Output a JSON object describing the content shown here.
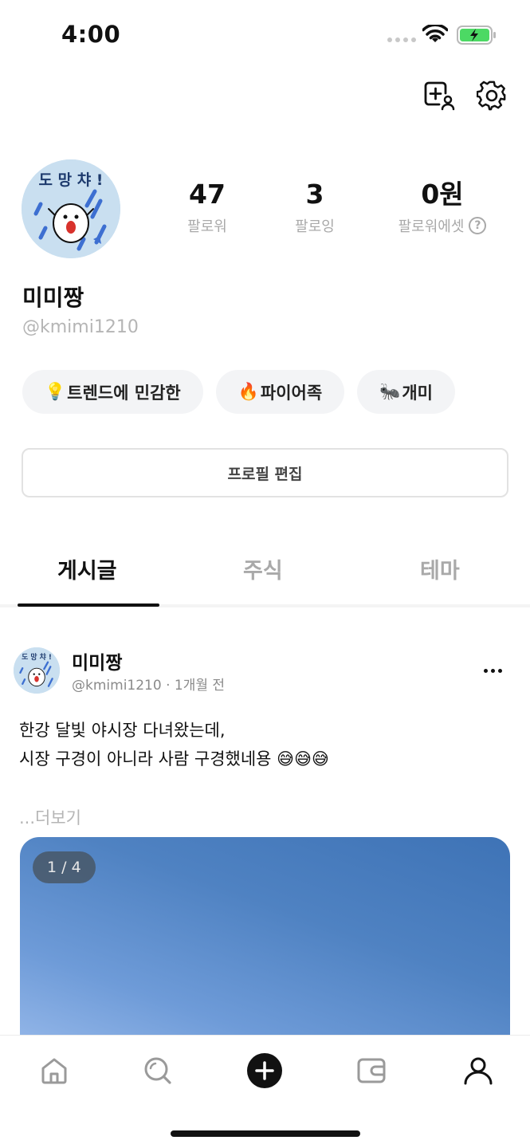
{
  "status_bar": {
    "time": "4:00"
  },
  "profile": {
    "display_name": "미미짱",
    "handle": "@kmimi1210",
    "avatar_text": "도 망 챠 !",
    "stats": {
      "followers_value": "47",
      "followers_label": "팔로워",
      "following_value": "3",
      "following_label": "팔로잉",
      "assets_value": "0원",
      "assets_label": "팔로워에셋"
    },
    "badges": [
      {
        "emoji": "💡",
        "label": "트렌드에 민감한"
      },
      {
        "emoji": "🔥",
        "label": "파이어족"
      },
      {
        "emoji": "🐜",
        "label": "개미"
      }
    ],
    "edit_button": "프로필 편집"
  },
  "tabs": [
    {
      "label": "게시글",
      "active": true
    },
    {
      "label": "주식",
      "active": false
    },
    {
      "label": "테마",
      "active": false
    }
  ],
  "post": {
    "author": "미미짱",
    "handle": "@kmimi1210",
    "time": "· 1개월 전",
    "body": "한강 달빛 야시장 다녀왔는데,\n시장 구경이 아니라 사람 구경했네용 😅😅😅",
    "read_more": "...더보기",
    "image_counter": "1 / 4"
  },
  "colors": {
    "accent": "#111111",
    "muted": "#a9a9a9",
    "badge_bg": "#f3f4f6",
    "battery": "#4cd964"
  },
  "icons": [
    "add-friend-icon",
    "settings-gear-icon",
    "help-icon",
    "more-icon",
    "home-icon",
    "search-icon",
    "plus-icon",
    "wallet-icon",
    "profile-icon",
    "wifi-icon",
    "battery-icon"
  ]
}
